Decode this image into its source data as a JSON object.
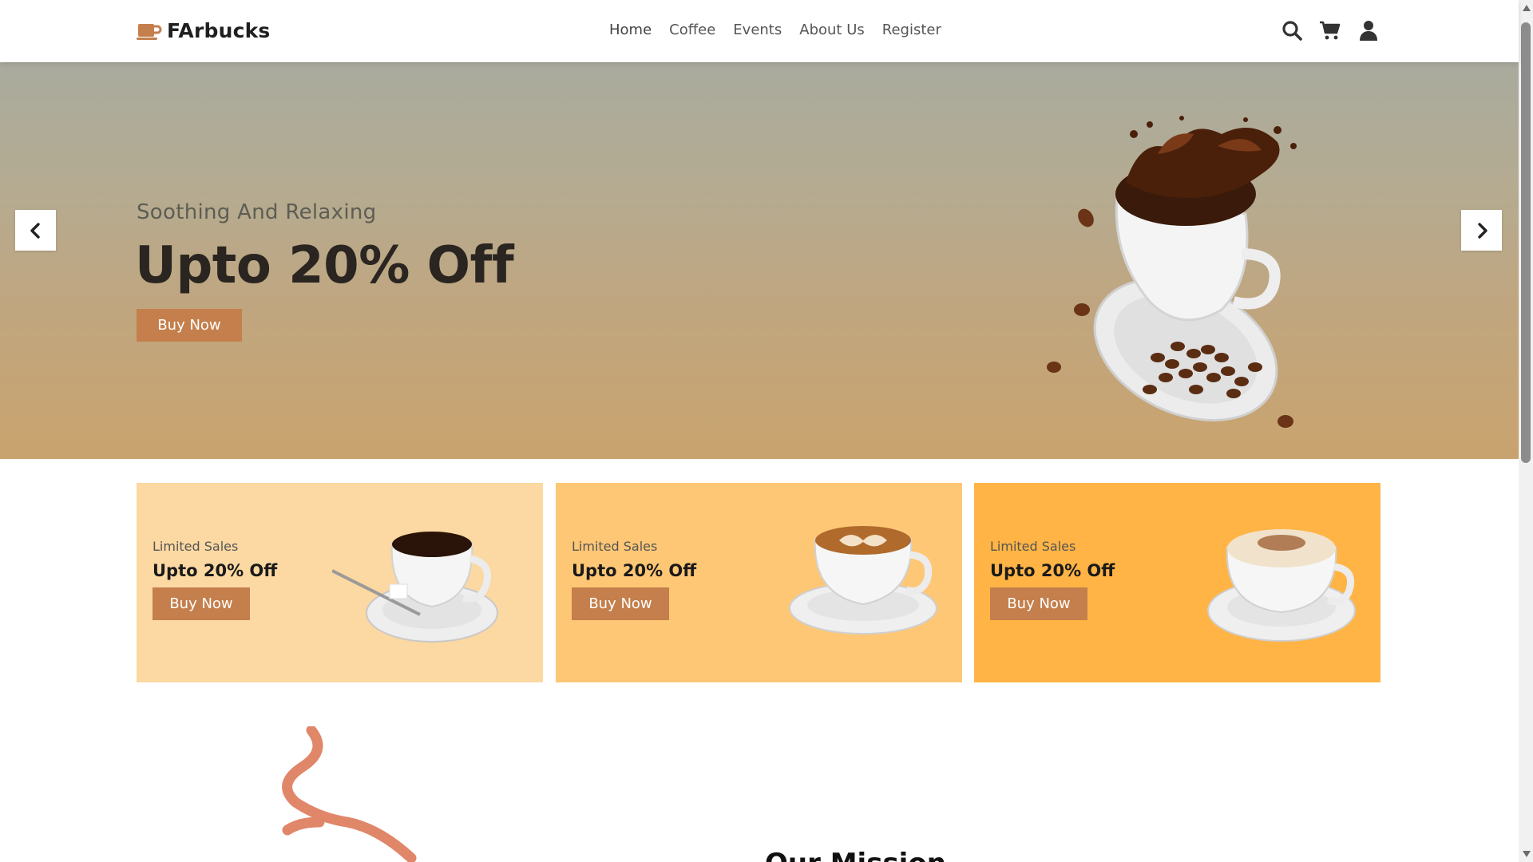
{
  "brand": {
    "name": "FArbucks",
    "logo_icon": "coffee-cup-icon",
    "accent": "#c47f4c"
  },
  "nav": {
    "links": [
      {
        "label": "Home"
      },
      {
        "label": "Coffee"
      },
      {
        "label": "Events"
      },
      {
        "label": "About Us"
      },
      {
        "label": "Register"
      }
    ],
    "icons": [
      "search-icon",
      "cart-icon",
      "user-icon"
    ]
  },
  "hero": {
    "subtitle": "Soothing And Relaxing",
    "title": "Upto 20% Off",
    "button_label": "Buy Now",
    "image": "coffee-cup-splash-image",
    "prev_icon": "chevron-left-icon",
    "next_icon": "chevron-right-icon"
  },
  "cards": [
    {
      "label": "Limited Sales",
      "title": "Upto 20% Off",
      "button_label": "Buy Now",
      "bg": "#fcd8a2",
      "image": "black-coffee-cup-image"
    },
    {
      "label": "Limited Sales",
      "title": "Upto 20% Off",
      "button_label": "Buy Now",
      "bg": "#fec775",
      "image": "latte-art-cup-image"
    },
    {
      "label": "Limited Sales",
      "title": "Upto 20% Off",
      "button_label": "Buy Now",
      "bg": "#ffb445",
      "image": "cappuccino-cup-image"
    }
  ],
  "mission": {
    "title": "Our Mission"
  }
}
